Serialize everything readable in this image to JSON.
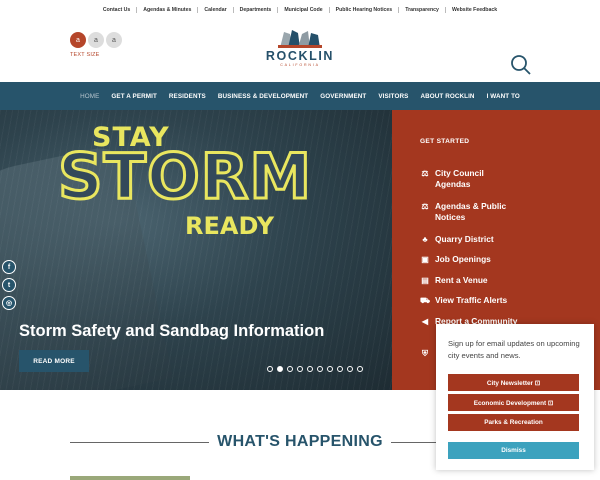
{
  "utility_links": [
    "Contact Us",
    "Agendas & Minutes",
    "Calendar",
    "Departments",
    "Municipal Code",
    "Public Hearing Notices",
    "Transparency",
    "Website Feedback"
  ],
  "text_size": {
    "label": "TEXT SIZE",
    "buttons": [
      "a",
      "a",
      "a"
    ]
  },
  "logo": {
    "name": "ROCKLIN",
    "subtitle": "CALIFORNIA"
  },
  "nav": [
    "HOME",
    "GET A PERMIT",
    "RESIDENTS",
    "BUSINESS & DEVELOPMENT",
    "GOVERNMENT",
    "VISITORS",
    "ABOUT ROCKLIN",
    "I WANT TO"
  ],
  "hero": {
    "stay": "STAY",
    "storm": "STORM",
    "ready": "READY",
    "title": "Storm Safety and Sandbag Information",
    "button": "READ MORE",
    "slide_count": 10,
    "active_slide": 2
  },
  "social": [
    "f",
    "t",
    "◎"
  ],
  "get_started": {
    "title": "GET STARTED",
    "items": [
      {
        "icon": "gavel-icon",
        "glyph": "⚖",
        "line1": "City Council",
        "line2": "Agendas"
      },
      {
        "icon": "gavel-icon",
        "glyph": "⚖",
        "line1": "Agendas & Public",
        "line2": "Notices"
      },
      {
        "icon": "tree-icon",
        "glyph": "♣",
        "line1": "Quarry District",
        "line2": ""
      },
      {
        "icon": "briefcase-icon",
        "glyph": "▣",
        "line1": "Job Openings",
        "line2": ""
      },
      {
        "icon": "ticket-icon",
        "glyph": "▤",
        "line1": "Rent a Venue",
        "line2": ""
      },
      {
        "icon": "car-icon",
        "glyph": "⛟",
        "line1": "View Traffic Alerts",
        "line2": ""
      },
      {
        "icon": "megaphone-icon",
        "glyph": "◀",
        "line1": "Report a Community",
        "line2": ""
      }
    ]
  },
  "popup": {
    "text": "Sign up for email updates on upcoming city events and news.",
    "buttons": [
      "City Newsletter ⊡",
      "Economic Development ⊡",
      "Parks & Recreation"
    ],
    "dismiss": "Dismiss"
  },
  "section_title": "WHAT'S HAPPENING"
}
